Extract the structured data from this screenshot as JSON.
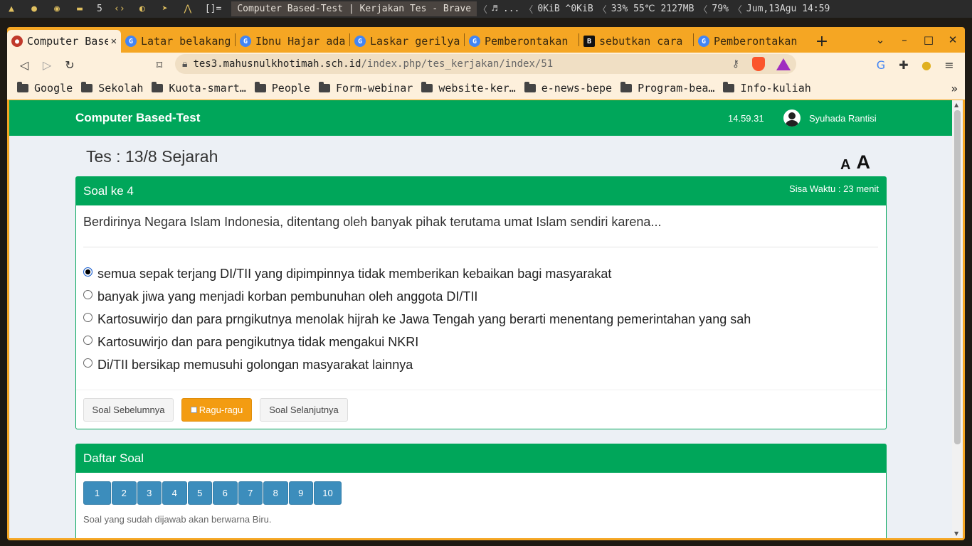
{
  "sysbar": {
    "workspace": "5",
    "bracket": "[]=",
    "title": "Computer Based-Test | Kerjakan Tes - Brave",
    "music": "...",
    "net": "0KiB ^0KiB",
    "cpu": "33%",
    "temp": "55℃",
    "mem": "2127MB",
    "vol": "79%",
    "date": "Jum,13Agu 14:59"
  },
  "tabs": [
    {
      "label": "Computer Based-Test | Kerjakan Tes",
      "active": true
    },
    {
      "label": "Latar belakang"
    },
    {
      "label": "Ibnu Hajar ada"
    },
    {
      "label": "Laskar gerilya"
    },
    {
      "label": "Pemberontakan"
    },
    {
      "label": "sebutkan cara"
    },
    {
      "label": "Pemberontakan"
    }
  ],
  "omnibox": {
    "host": "tes3.mahusnulkhotimah.sch.id",
    "path": "/index.php/tes_kerjakan/index/51"
  },
  "bookmarks": [
    "Google",
    "Sekolah",
    "Kuota-smart…",
    "People",
    "Form-webinar",
    "website-ker…",
    "e-news-bepe",
    "Program-bea…",
    "Info-kuliah"
  ],
  "navbar": {
    "brand": "Computer Based-Test",
    "clock": "14.59.31",
    "user": "Syuhada Rantisi"
  },
  "test": {
    "title": "Tes : 13/8 Sejarah",
    "font_small": "A",
    "font_big": "A"
  },
  "question": {
    "header": "Soal ke 4",
    "timer": "Sisa Waktu : 23 menit",
    "text": "Berdirinya Negara Islam Indonesia, ditentang oleh banyak pihak terutama umat Islam sendiri karena...",
    "options": [
      {
        "text": "semua sepak terjang DI/TII yang dipimpinnya tidak memberikan kebaikan bagi masyarakat",
        "selected": true
      },
      {
        "text": "banyak jiwa yang menjadi korban pembunuhan oleh anggota DI/TII",
        "selected": false
      },
      {
        "text": "Kartosuwirjo dan para prngikutnya menolak hijrah ke Jawa Tengah yang berarti menentang pemerintahan yang sah",
        "selected": false
      },
      {
        "text": "Kartosuwirjo dan para pengikutnya tidak mengakui NKRI",
        "selected": false
      },
      {
        "text": "Di/TII bersikap memusuhi golongan masyarakat lainnya",
        "selected": false
      }
    ],
    "btn_prev": "Soal Sebelumnya",
    "btn_ragu": "Ragu-ragu",
    "btn_next": "Soal Selanjutnya"
  },
  "daftar": {
    "header": "Daftar Soal",
    "numbers": [
      "1",
      "2",
      "3",
      "4",
      "5",
      "6",
      "7",
      "8",
      "9",
      "10"
    ],
    "note": "Soal yang sudah dijawab akan berwarna Biru."
  }
}
